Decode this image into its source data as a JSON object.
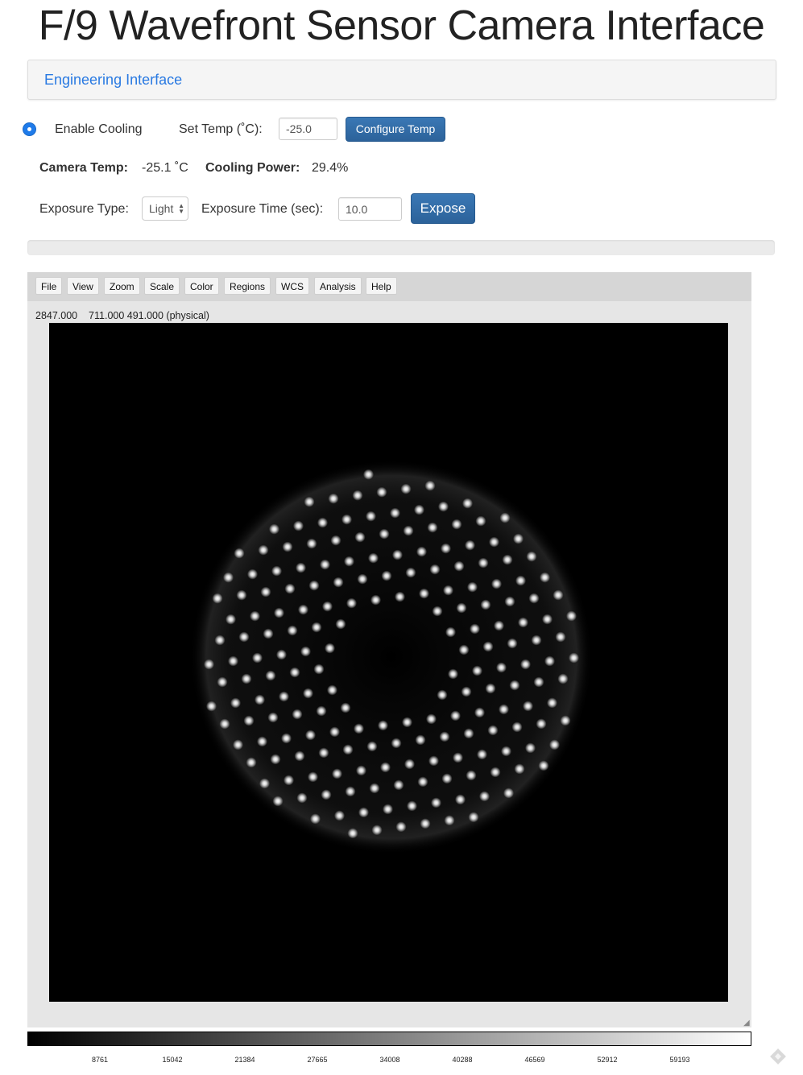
{
  "page": {
    "title": "F/9 Wavefront Sensor Camera Interface",
    "engineering_link": "Engineering Interface"
  },
  "cooling": {
    "enable_label": "Enable Cooling",
    "enabled": true,
    "set_temp_label": "Set Temp (˚C):",
    "set_temp_value": "-25.0",
    "configure_button": "Configure Temp"
  },
  "status": {
    "camera_temp_label": "Camera Temp:",
    "camera_temp_value": "-25.1 ˚C",
    "cooling_power_label": "Cooling Power:",
    "cooling_power_value": "29.4%"
  },
  "exposure": {
    "type_label": "Exposure Type:",
    "type_value": "Light",
    "time_label": "Exposure Time (sec):",
    "time_value": "10.0",
    "expose_button": "Expose"
  },
  "progress": {
    "value": 0
  },
  "ds9": {
    "menu": [
      "File",
      "View",
      "Zoom",
      "Scale",
      "Color",
      "Regions",
      "WCS",
      "Analysis",
      "Help"
    ],
    "pixel_value": "2847.000",
    "coords": "711.000 491.000 (physical)",
    "colorbar_ticks": [
      "8761",
      "15042",
      "21384",
      "27665",
      "34008",
      "40288",
      "46569",
      "52912",
      "59193"
    ]
  },
  "icons": {
    "radio": "radio-selected-icon",
    "resize": "resize-grip-icon",
    "corner": "feedback-icon"
  }
}
